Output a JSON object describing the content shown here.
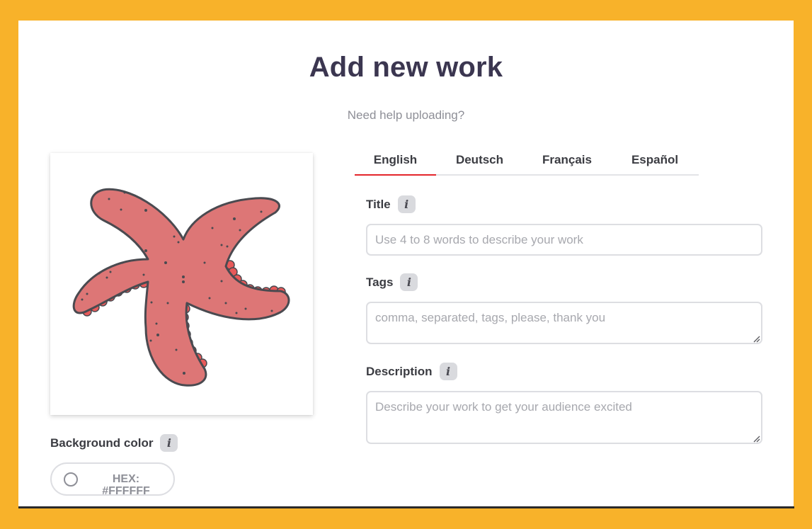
{
  "page": {
    "title": "Add new work",
    "help_link": "Need help uploading?"
  },
  "colors": {
    "background": "#F8B22A",
    "title_text": "#3b3650",
    "active_tab_underline": "#e4262c",
    "starfish_fill": "#dd7676",
    "starfish_outline": "#4a4a50",
    "starfish_suckers": "#e85a5a"
  },
  "preview": {
    "image_description": "starfish illustration"
  },
  "background_color": {
    "label": "Background color",
    "hex_label": "HEX:",
    "hex_value": "#FFFFFF",
    "swatch": "#FFFFFF"
  },
  "tabs": [
    {
      "label": "English",
      "active": true
    },
    {
      "label": "Deutsch",
      "active": false
    },
    {
      "label": "Français",
      "active": false
    },
    {
      "label": "Español",
      "active": false
    }
  ],
  "form": {
    "title": {
      "label": "Title",
      "value": "",
      "placeholder": "Use 4 to 8 words to describe your work"
    },
    "tags": {
      "label": "Tags",
      "value": "",
      "placeholder": "comma, separated, tags, please, thank you"
    },
    "description": {
      "label": "Description",
      "value": "",
      "placeholder": "Describe your work to get your audience excited"
    }
  },
  "icons": {
    "info": "i"
  }
}
